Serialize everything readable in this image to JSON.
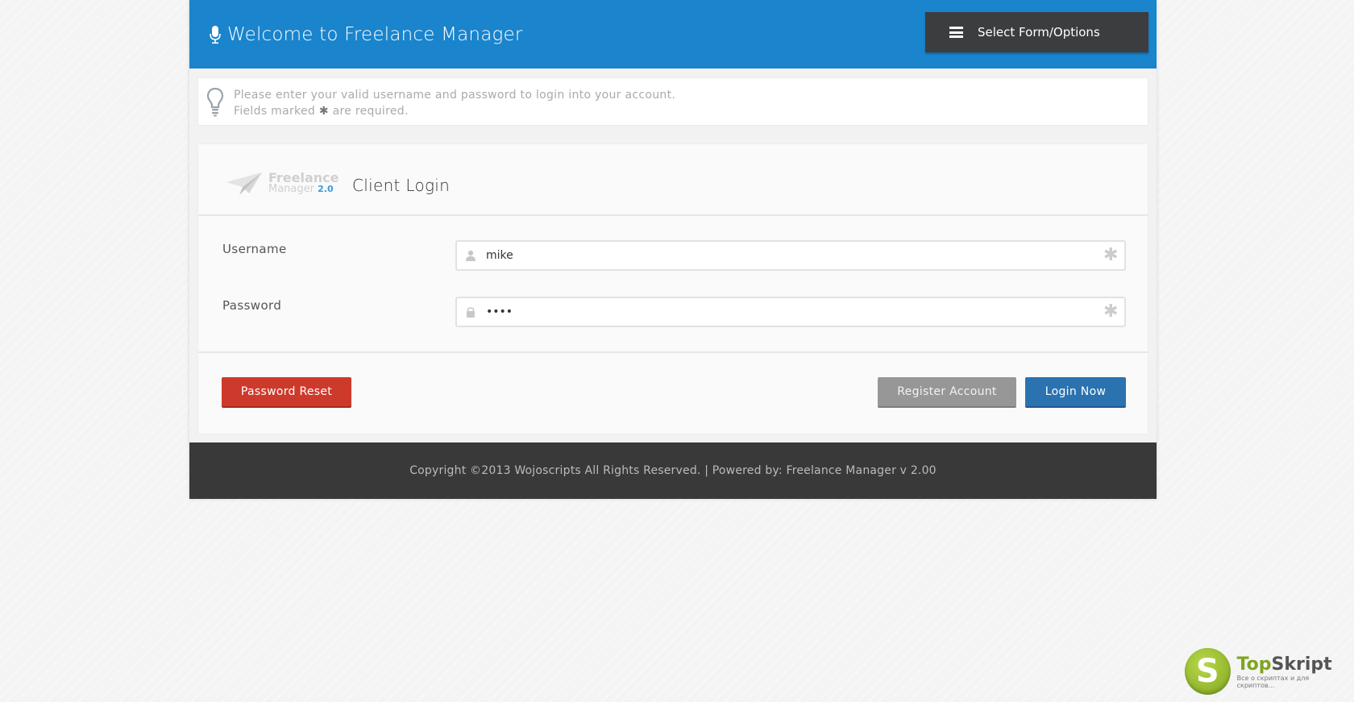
{
  "header": {
    "title": "Welcome to Freelance Manager",
    "options_label": "Select Form/Options"
  },
  "notice": {
    "line1": "Please enter your valid username and password to login into your account.",
    "line2_prefix": "Fields marked",
    "line2_mark": "✱",
    "line2_suffix": "are required."
  },
  "logo": {
    "line1": "Freelance",
    "line2": "Manager",
    "version": "2.0"
  },
  "panel": {
    "title": "Client Login"
  },
  "form": {
    "username": {
      "label": "Username",
      "value": "mike"
    },
    "password": {
      "label": "Password",
      "value": "mike"
    },
    "required_mark": "✱"
  },
  "actions": {
    "reset_label": "Password Reset",
    "register_label": "Register Account",
    "login_label": "Login Now"
  },
  "footer": {
    "text": "Copyright ©2013 Wojoscripts All Rights Reserved. | Powered by: Freelance Manager v 2.00"
  },
  "badge": {
    "letter": "S",
    "name_a": "Top",
    "name_b": "Skript",
    "tagline": "Все о скриптах и для скриптов..."
  },
  "colors": {
    "header": "#1a84cc",
    "reset": "#cd3a2c",
    "register": "#979797",
    "login": "#2b72b0",
    "footer": "#393939"
  }
}
